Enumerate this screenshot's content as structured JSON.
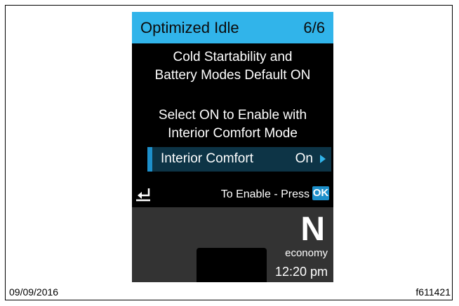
{
  "header": {
    "title": "Optimized Idle",
    "page": "6/6",
    "bg_color": "#31b4ea"
  },
  "info": {
    "line1": "Cold Startability and",
    "line2": "Battery Modes Default ON",
    "line3": "Select ON to Enable with",
    "line4": "Interior Comfort Mode"
  },
  "menu_row": {
    "label": "Interior Comfort",
    "value": "On"
  },
  "footer_hint": {
    "text": "To Enable - Press",
    "ok_label": "OK"
  },
  "status": {
    "gear": "N",
    "mode": "economy",
    "time": "12:20 pm"
  },
  "caption": {
    "date": "09/09/2016",
    "figure_id": "f611421"
  },
  "icons": {
    "back": "back-arrow-icon",
    "arrow": "right-triangle-icon",
    "ok": "ok-button-icon"
  }
}
